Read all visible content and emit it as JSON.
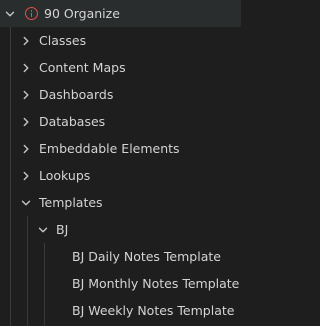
{
  "tree": {
    "root": {
      "label": "90 Organize",
      "expanded": true,
      "icon": "info-circle-icon"
    },
    "items": [
      {
        "label": "Classes",
        "expanded": false
      },
      {
        "label": "Content Maps",
        "expanded": false
      },
      {
        "label": "Dashboards",
        "expanded": false
      },
      {
        "label": "Databases",
        "expanded": false
      },
      {
        "label": "Embeddable Elements",
        "expanded": false
      },
      {
        "label": "Lookups",
        "expanded": false
      },
      {
        "label": "Templates",
        "expanded": true
      }
    ],
    "templates_folder": {
      "label": "BJ",
      "expanded": true
    },
    "templates_files": [
      {
        "label": "BJ Daily Notes Template"
      },
      {
        "label": "BJ Monthly Notes Template"
      },
      {
        "label": "BJ Weekly Notes Template"
      }
    ]
  },
  "colors": {
    "background": "#1e1e1e",
    "text": "#d4d4d4",
    "chevron": "#c5c5c5",
    "info_icon": "#e55048",
    "guide_line": "#3a3a3a"
  }
}
